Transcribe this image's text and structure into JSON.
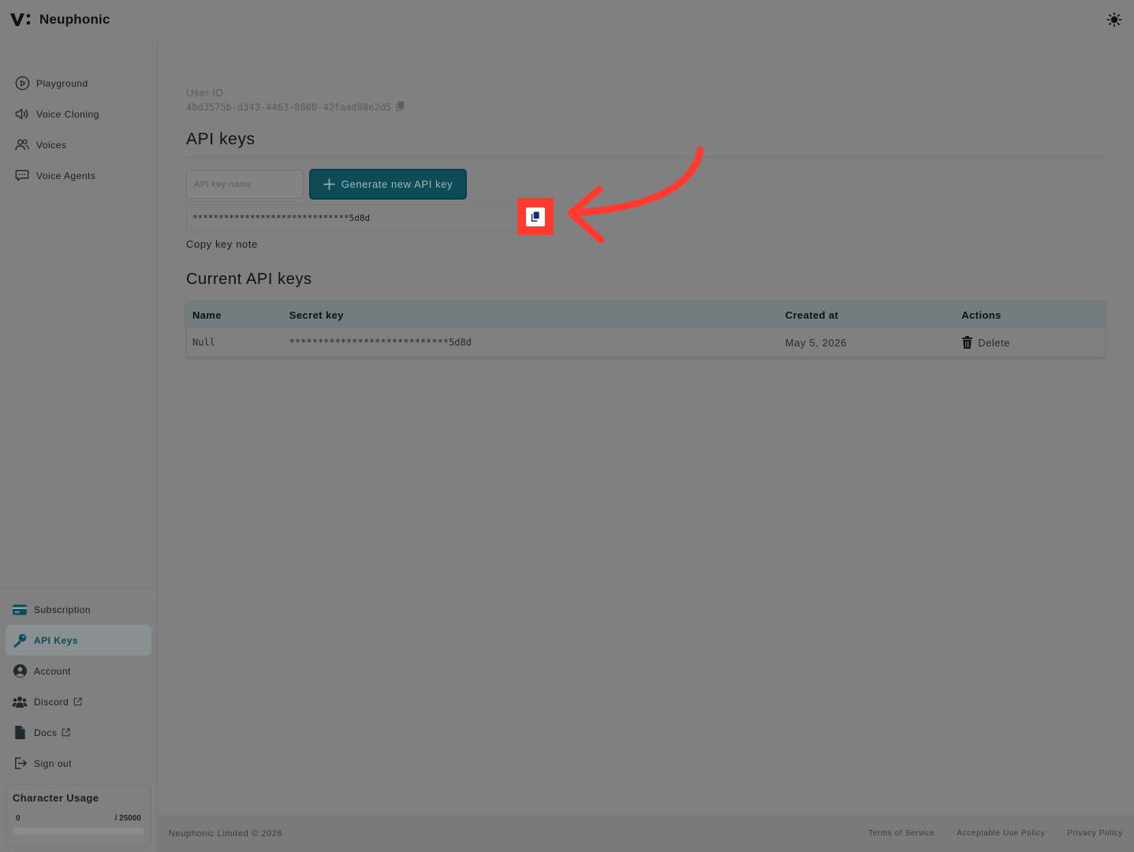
{
  "brand": {
    "name": "Neuphonic"
  },
  "sidebar": {
    "items": [
      {
        "label": "Playground",
        "icon": "play-circle-icon"
      },
      {
        "label": "Voice Cloning",
        "icon": "speaker-wave-icon"
      },
      {
        "label": "Voices",
        "icon": "users-icon"
      },
      {
        "label": "Voice Agents",
        "icon": "chat-bubble-icon"
      }
    ],
    "bottom_items": [
      {
        "label": "Subscription",
        "icon": "credit-card-icon"
      },
      {
        "label": "API Keys",
        "icon": "key-icon",
        "active": true
      },
      {
        "label": "Account",
        "icon": "user-circle-icon"
      },
      {
        "label": "Discord",
        "icon": "users-group-icon",
        "external": true
      },
      {
        "label": "Docs",
        "icon": "document-icon",
        "external": true
      },
      {
        "label": "Sign out",
        "icon": "sign-out-icon"
      }
    ]
  },
  "usage": {
    "title": "Character Usage",
    "used": "0",
    "limit": "/ 25000",
    "fraction": 0
  },
  "main": {
    "user_id_label": "User ID",
    "user_id": "4bd3575b-d343-4463-8800-42faad98e2d5",
    "api_keys_heading": "API keys",
    "key_name_placeholder": "API key name",
    "generate_label": "Generate new API key",
    "new_key_value": "******************************5d8d",
    "copy_note": "Copy key note",
    "current_heading": "Current API keys"
  },
  "table": {
    "headers": [
      "Name",
      "Secret key",
      "Created at",
      "Actions"
    ],
    "rows": [
      {
        "name": "Null",
        "secret": "****************************5d8d",
        "created": "May 5, 2026",
        "action": "Delete"
      }
    ]
  },
  "footer": {
    "copyright": "Neuphonic Limited © 2026",
    "links": [
      "Terms of Service",
      "Acceptable Use Policy",
      "Privacy Policy"
    ]
  },
  "colors": {
    "accent": "#0d4c57",
    "highlight": "#ff3b30",
    "overlay": "#808080"
  }
}
